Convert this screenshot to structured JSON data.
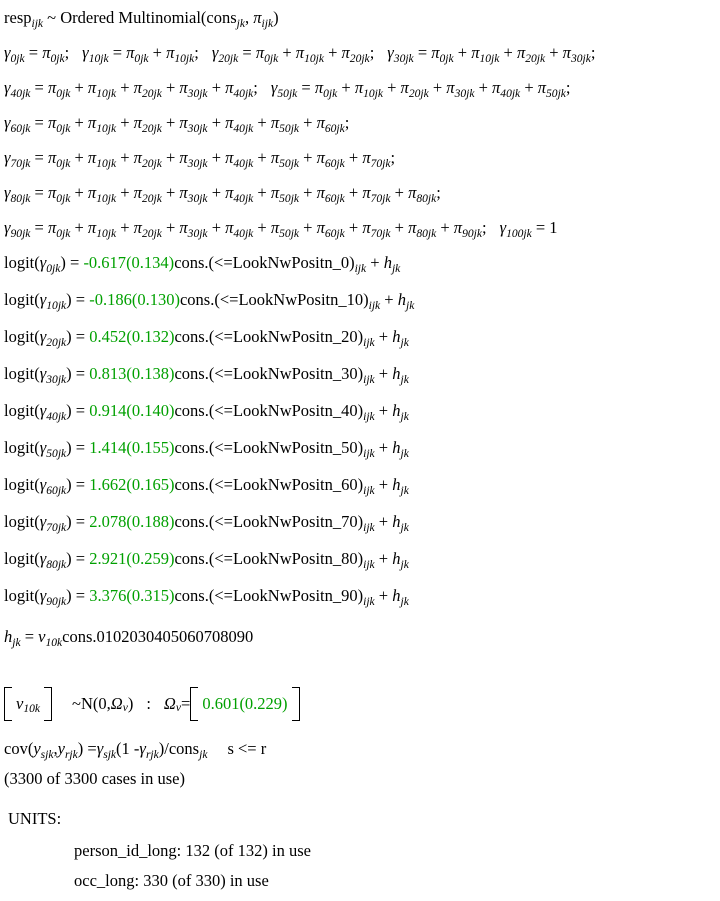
{
  "model": {
    "response_line": {
      "response": "resp",
      "response_sub": "ijk",
      "tilde": "~",
      "distribution": "Ordered Multinomial",
      "denominator": "cons",
      "denominator_sub": "jk",
      "prob": "π",
      "prob_sub": "ijk"
    },
    "gamma_symbol": "γ",
    "pi_symbol": "π",
    "cumulative_equations": [
      {
        "lhs_sub": "0jk",
        "terms": [
          "0jk"
        ]
      },
      {
        "lhs_sub": "10jk",
        "terms": [
          "0jk",
          "10jk"
        ]
      },
      {
        "lhs_sub": "20jk",
        "terms": [
          "0jk",
          "10jk",
          "20jk"
        ]
      },
      {
        "lhs_sub": "30jk",
        "terms": [
          "0jk",
          "10jk",
          "20jk",
          "30jk"
        ]
      },
      {
        "lhs_sub": "40jk",
        "terms": [
          "0jk",
          "10jk",
          "20jk",
          "30jk",
          "40jk"
        ]
      },
      {
        "lhs_sub": "50jk",
        "terms": [
          "0jk",
          "10jk",
          "20jk",
          "30jk",
          "40jk",
          "50jk"
        ]
      },
      {
        "lhs_sub": "60jk",
        "terms": [
          "0jk",
          "10jk",
          "20jk",
          "30jk",
          "40jk",
          "50jk",
          "60jk"
        ]
      },
      {
        "lhs_sub": "70jk",
        "terms": [
          "0jk",
          "10jk",
          "20jk",
          "30jk",
          "40jk",
          "50jk",
          "60jk",
          "70jk"
        ]
      },
      {
        "lhs_sub": "80jk",
        "terms": [
          "0jk",
          "10jk",
          "20jk",
          "30jk",
          "40jk",
          "50jk",
          "60jk",
          "70jk",
          "80jk"
        ]
      },
      {
        "lhs_sub": "90jk",
        "terms": [
          "0jk",
          "10jk",
          "20jk",
          "30jk",
          "40jk",
          "50jk",
          "60jk",
          "70jk",
          "80jk",
          "90jk"
        ]
      }
    ],
    "top_category": {
      "lhs_sub": "100jk",
      "value": "1"
    },
    "logit_label": "logit",
    "logit_equations": [
      {
        "lhs_sub": "0jk",
        "estimate": "-0.617",
        "se": "(0.134)",
        "predictor": "cons.(<=LookNwPositn_0)",
        "pred_sub": "ijk",
        "random": "h",
        "random_sub": "jk"
      },
      {
        "lhs_sub": "10jk",
        "estimate": "-0.186",
        "se": "(0.130)",
        "predictor": "cons.(<=LookNwPositn_10)",
        "pred_sub": "ijk",
        "random": "h",
        "random_sub": "jk"
      },
      {
        "lhs_sub": "20jk",
        "estimate": "0.452",
        "se": "(0.132)",
        "predictor": "cons.(<=LookNwPositn_20)",
        "pred_sub": "ijk",
        "random": "h",
        "random_sub": "jk"
      },
      {
        "lhs_sub": "30jk",
        "estimate": "0.813",
        "se": "(0.138)",
        "predictor": "cons.(<=LookNwPositn_30)",
        "pred_sub": "ijk",
        "random": "h",
        "random_sub": "jk"
      },
      {
        "lhs_sub": "40jk",
        "estimate": "0.914",
        "se": "(0.140)",
        "predictor": "cons.(<=LookNwPositn_40)",
        "pred_sub": "ijk",
        "random": "h",
        "random_sub": "jk"
      },
      {
        "lhs_sub": "50jk",
        "estimate": "1.414",
        "se": "(0.155)",
        "predictor": "cons.(<=LookNwPositn_50)",
        "pred_sub": "ijk",
        "random": "h",
        "random_sub": "jk"
      },
      {
        "lhs_sub": "60jk",
        "estimate": "1.662",
        "se": "(0.165)",
        "predictor": "cons.(<=LookNwPositn_60)",
        "pred_sub": "ijk",
        "random": "h",
        "random_sub": "jk"
      },
      {
        "lhs_sub": "70jk",
        "estimate": "2.078",
        "se": "(0.188)",
        "predictor": "cons.(<=LookNwPositn_70)",
        "pred_sub": "ijk",
        "random": "h",
        "random_sub": "jk"
      },
      {
        "lhs_sub": "80jk",
        "estimate": "2.921",
        "se": "(0.259)",
        "predictor": "cons.(<=LookNwPositn_80)",
        "pred_sub": "ijk",
        "random": "h",
        "random_sub": "jk"
      },
      {
        "lhs_sub": "90jk",
        "estimate": "3.376",
        "se": "(0.315)",
        "predictor": "cons.(<=LookNwPositn_90)",
        "pred_sub": "ijk",
        "random": "h",
        "random_sub": "jk"
      }
    ],
    "level2_equation": {
      "lhs": "h",
      "lhs_sub": "jk",
      "rhs_var": "v",
      "rhs_var_sub": "10k",
      "rhs_cons": "cons.0102030405060708090"
    },
    "random_part": {
      "vector_var": "v",
      "vector_var_sub": "10k",
      "tilde": "~",
      "dist": "N(0,",
      "omega": "Ω",
      "omega_sub": "v",
      "dist_close": ")",
      "colon": ":",
      "omega2": "Ω",
      "omega2_sub": "v",
      "equals": "=",
      "variance": "0.601(0.229)"
    },
    "covariance": {
      "cov_label": "cov",
      "y": "y",
      "s_sub": "sjk",
      "r_sub": "rjk",
      "gamma": "γ",
      "cons": "cons",
      "cons_sub": "jk",
      "condition": "s <= r"
    },
    "cases_line": "(3300 of 3300 cases in use)",
    "units_heading": "UNITS:",
    "units": [
      {
        "label": "person_id_long:",
        "count": "132",
        "of": "(of 132)",
        "status": "in use"
      },
      {
        "label": "occ_long:",
        "count": "330",
        "of": "(of 330)",
        "status": "in use"
      }
    ]
  },
  "colors": {
    "estimate_green": "#00a000",
    "text_black": "#000000",
    "background": "#ffffff"
  }
}
